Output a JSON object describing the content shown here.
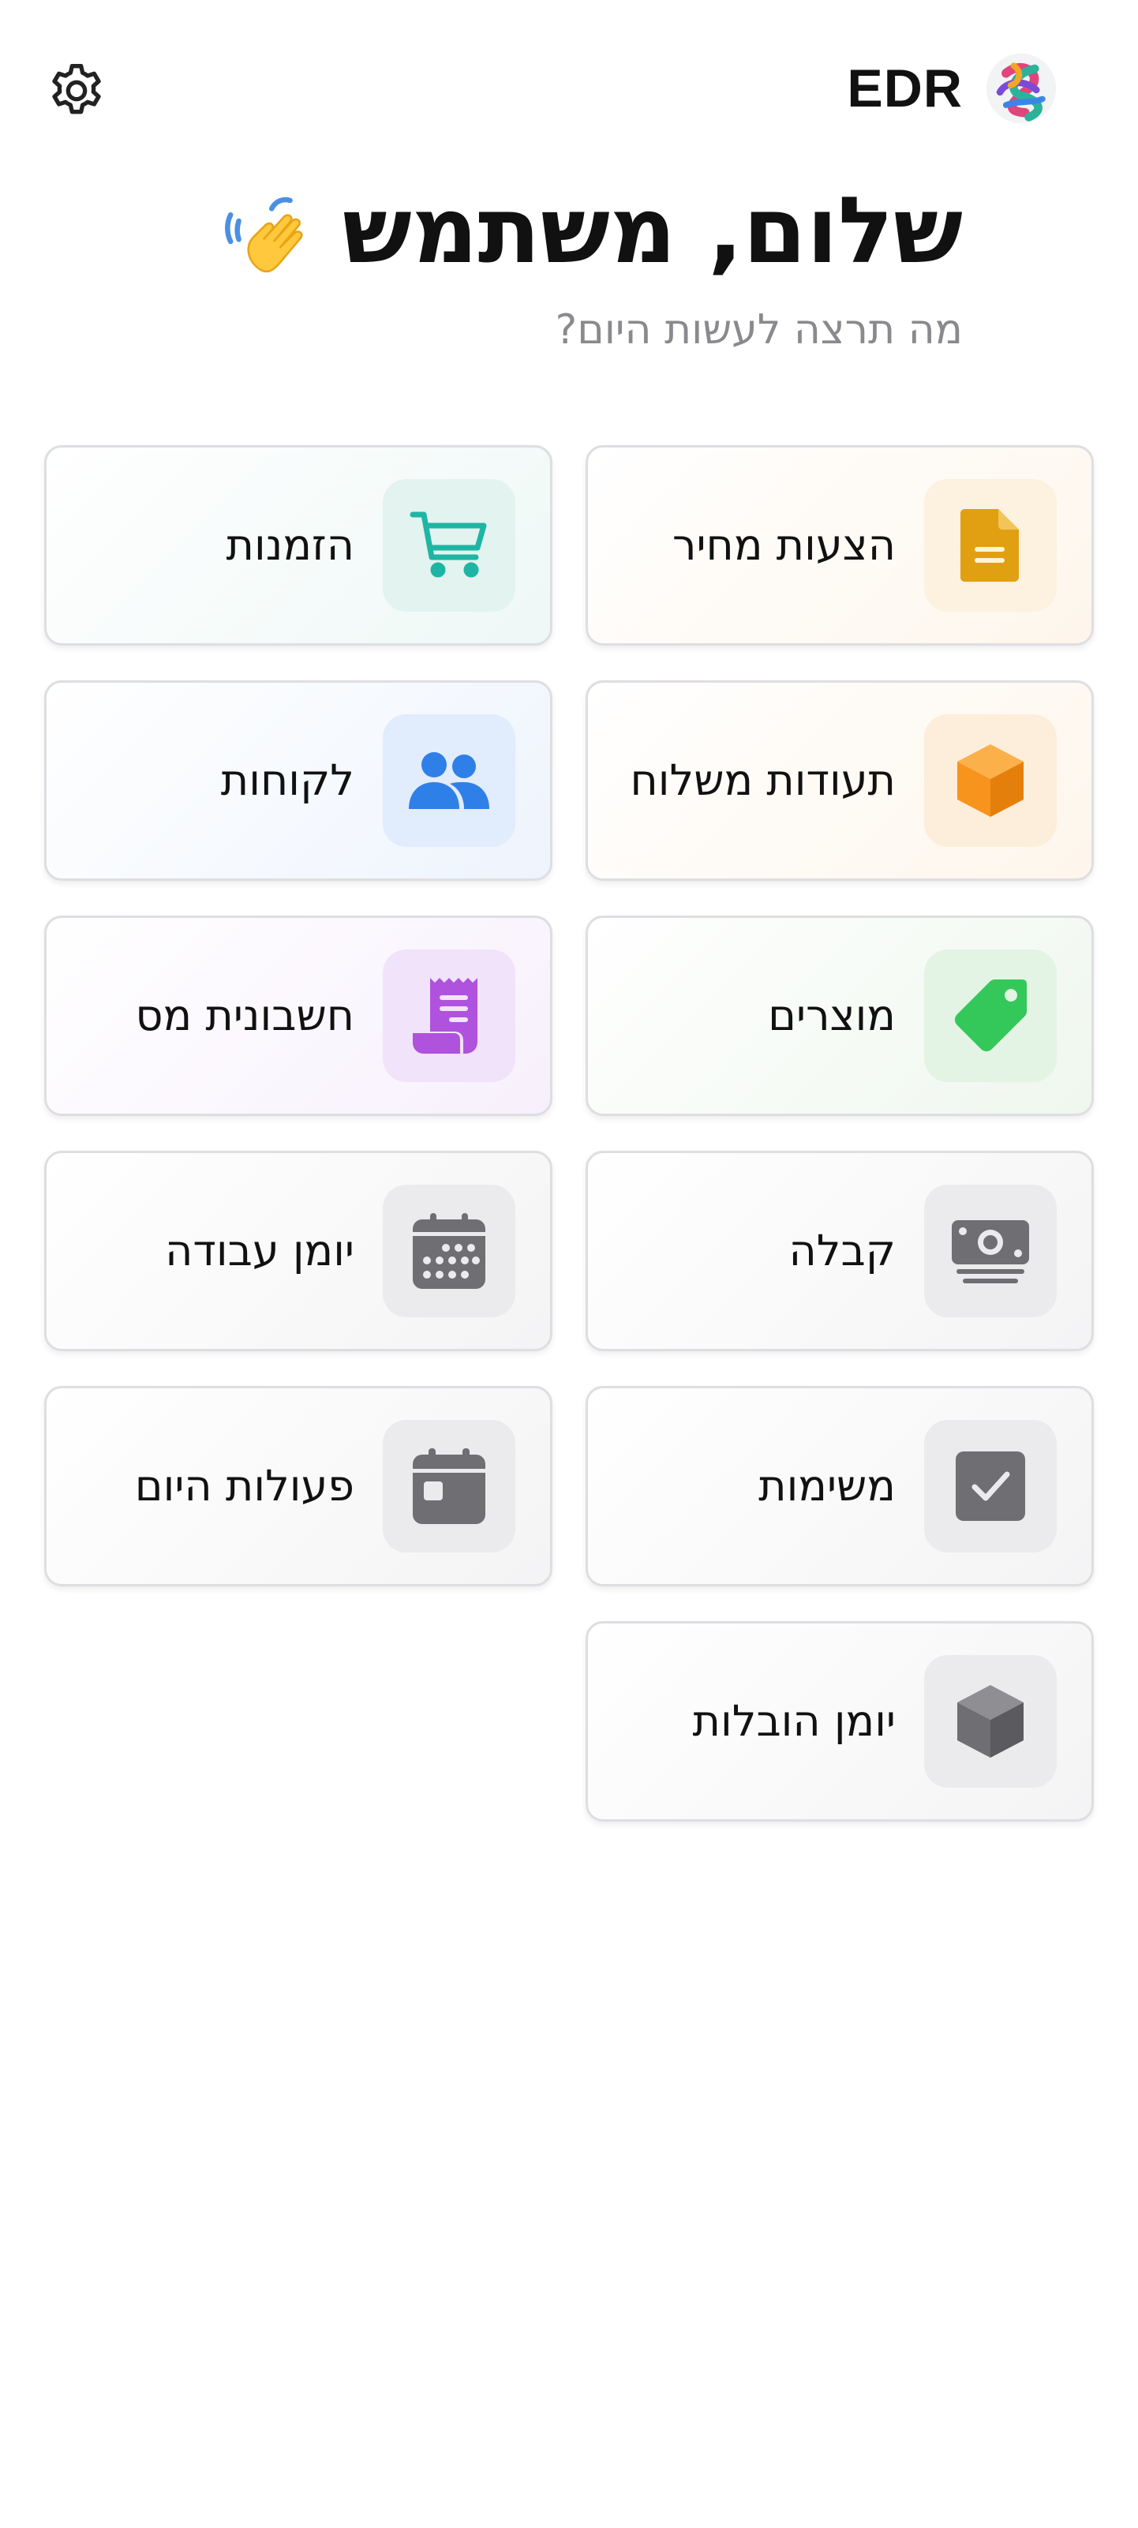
{
  "header": {
    "brand_name": "EDR",
    "settings_icon": "gear-icon",
    "logo_icon": "colorful-knot-logo"
  },
  "greeting": {
    "title": "שלום, משתמש",
    "emoji_icon": "waving-hand-icon",
    "subtitle": "מה תרצה לעשות היום?"
  },
  "tiles": [
    {
      "label": "הצעות מחיר",
      "icon": "document-icon",
      "color": "#e0a012"
    },
    {
      "label": "הזמנות",
      "icon": "cart-icon",
      "color": "#1fb5a4"
    },
    {
      "label": "תעודות משלוח",
      "icon": "box-icon",
      "color": "#f7941d"
    },
    {
      "label": "לקוחות",
      "icon": "users-icon",
      "color": "#2f7fe8"
    },
    {
      "label": "מוצרים",
      "icon": "tag-icon",
      "color": "#34c759"
    },
    {
      "label": "חשבונית מס",
      "icon": "receipt-icon",
      "color": "#af52de"
    },
    {
      "label": "קבלה",
      "icon": "banknote-icon",
      "color": "#6e6e73"
    },
    {
      "label": "יומן עבודה",
      "icon": "calendar-icon",
      "color": "#6e6e73"
    },
    {
      "label": "משימות",
      "icon": "checkbox-icon",
      "color": "#6e6e73"
    },
    {
      "label": "פעולות היום",
      "icon": "calendar-day-icon",
      "color": "#6e6e73"
    },
    {
      "label": "יומן הובלות",
      "icon": "cube-icon",
      "color": "#6e6e73"
    }
  ]
}
